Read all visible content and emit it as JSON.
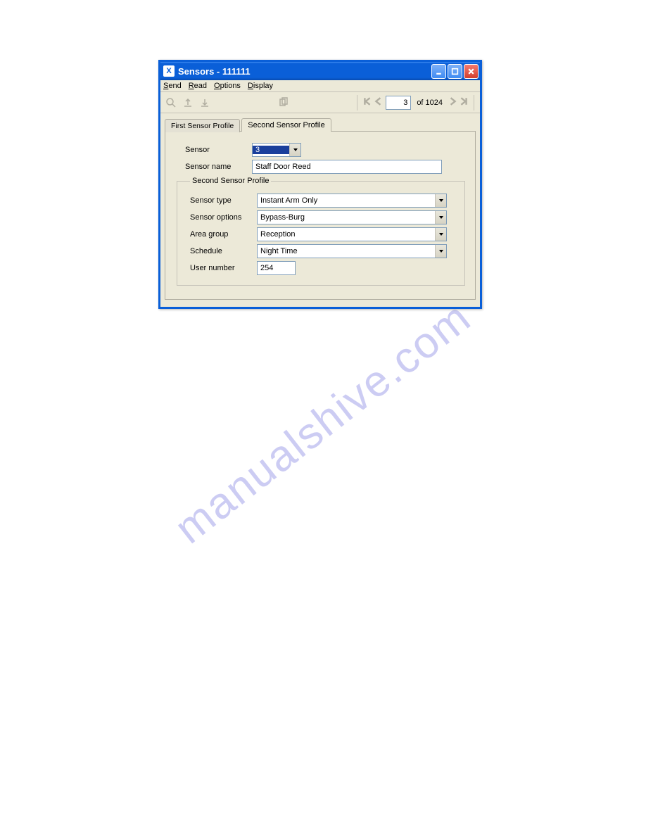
{
  "window": {
    "title": "Sensors - 111111",
    "app_icon_letter": "X"
  },
  "menu": {
    "send": "Send",
    "read": "Read",
    "options": "Options",
    "display": "Display"
  },
  "pager": {
    "current": "3",
    "total_label": "of 1024"
  },
  "tabs": {
    "first": "First Sensor Profile",
    "second": "Second Sensor Profile"
  },
  "form": {
    "sensor_label": "Sensor",
    "sensor_value": "3",
    "sensor_name_label": "Sensor name",
    "sensor_name_value": "Staff Door Reed",
    "group_legend": "Second Sensor Profile",
    "sensor_type_label": "Sensor type",
    "sensor_type_value": "Instant Arm Only",
    "sensor_options_label": "Sensor options",
    "sensor_options_value": "Bypass-Burg",
    "area_group_label": "Area group",
    "area_group_value": "Reception",
    "schedule_label": "Schedule",
    "schedule_value": "Night Time",
    "user_number_label": "User number",
    "user_number_value": "254"
  },
  "watermark": "manualshive.com"
}
